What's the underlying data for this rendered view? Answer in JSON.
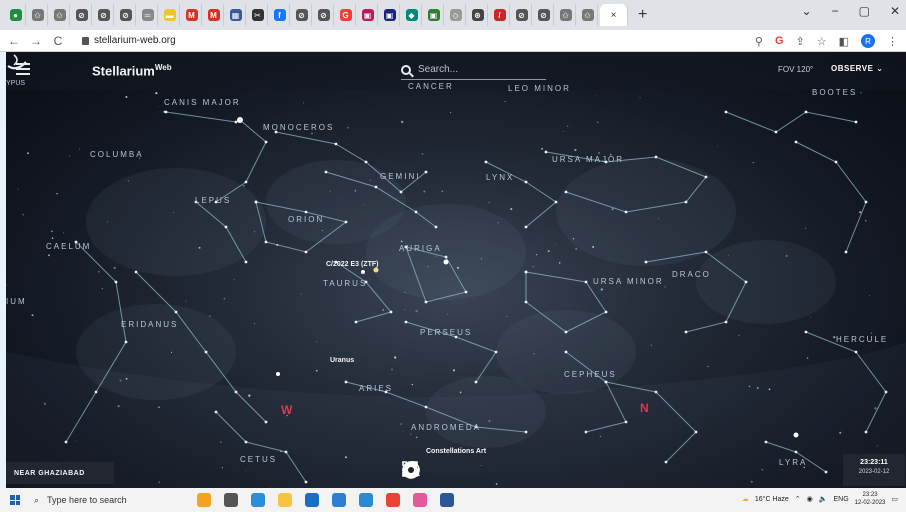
{
  "browser": {
    "tabs": [
      {
        "name": "tab-1",
        "color": "#1e8e3e",
        "glyph": "●"
      },
      {
        "name": "tab-2",
        "color": "#777",
        "glyph": "✩"
      },
      {
        "name": "tab-3",
        "color": "#777",
        "glyph": "✩"
      },
      {
        "name": "tab-4",
        "color": "#555",
        "glyph": "⊘"
      },
      {
        "name": "tab-5",
        "color": "#555",
        "glyph": "⊘"
      },
      {
        "name": "tab-6",
        "color": "#555",
        "glyph": "⊘"
      },
      {
        "name": "tab-7",
        "color": "#888",
        "glyph": "═"
      },
      {
        "name": "tab-8",
        "color": "#f2c230",
        "glyph": "▬"
      },
      {
        "name": "tab-9",
        "color": "#d93025",
        "glyph": "M"
      },
      {
        "name": "tab-10",
        "color": "#d93025",
        "glyph": "M"
      },
      {
        "name": "tab-11",
        "color": "#3b5998",
        "glyph": "▦"
      },
      {
        "name": "tab-12",
        "color": "#333",
        "glyph": "✂"
      },
      {
        "name": "tab-13",
        "color": "#1877f2",
        "glyph": "f"
      },
      {
        "name": "tab-14",
        "color": "#555",
        "glyph": "⊘"
      },
      {
        "name": "tab-15",
        "color": "#555",
        "glyph": "⊘"
      },
      {
        "name": "tab-16",
        "color": "#ea4335",
        "glyph": "G"
      },
      {
        "name": "tab-17",
        "color": "#c2185b",
        "glyph": "▣"
      },
      {
        "name": "tab-18",
        "color": "#1a237e",
        "glyph": "▣"
      },
      {
        "name": "tab-19",
        "color": "#00897b",
        "glyph": "◆"
      },
      {
        "name": "tab-20",
        "color": "#2e7d32",
        "glyph": "▣"
      },
      {
        "name": "tab-21",
        "color": "#999",
        "glyph": "◇"
      },
      {
        "name": "tab-22",
        "color": "#444",
        "glyph": "⊛"
      },
      {
        "name": "tab-23",
        "color": "#c62828",
        "glyph": "/"
      },
      {
        "name": "tab-24",
        "color": "#555",
        "glyph": "⊘"
      },
      {
        "name": "tab-25",
        "color": "#555",
        "glyph": "⊘"
      },
      {
        "name": "tab-26",
        "color": "#777",
        "glyph": "✩"
      },
      {
        "name": "tab-27",
        "color": "#777",
        "glyph": "✩"
      }
    ],
    "active_tab_close": "×",
    "new_tab": "+",
    "window_controls": [
      "⌄",
      "−",
      "▢",
      "✕"
    ],
    "url": "stellarium-web.org",
    "nav": {
      "back": "←",
      "forward": "→",
      "reload": "C"
    },
    "extensions": [
      "⚲",
      "G",
      "⇪",
      "☆",
      "◧"
    ],
    "profile_initial": "R"
  },
  "app": {
    "brand": "Stellarium",
    "brand_sup": "Web",
    "search_placeholder": "Search...",
    "fov": "FOV 120°",
    "observe": "OBSERVE",
    "location": "NEAR GHAZIABAD",
    "time": "23:23:11",
    "date": "2023-02-12",
    "tooltip": "Constellations Art",
    "accent": "#e0394a",
    "constellations": [
      "CANIS MAJOR",
      "MONOCEROS",
      "CANCER",
      "LEO MINOR",
      "BOOTES",
      "COLUMBA",
      "GEMINI",
      "LYNX",
      "URSA MAJOR",
      "LEPUS",
      "ORION",
      "CAELUM",
      "AURIGA",
      "TAURUS",
      "URSA MINOR",
      "DRACO",
      "ERIDANUS",
      "PERSEUS",
      "HERCULE",
      "ARIES",
      "CEPHEUS",
      "ANDROMEDA",
      "CETUS",
      "LYRA",
      "IUM",
      "YPUS"
    ],
    "planets": [
      "C/2022 E3 (ZTF)",
      "Uranus"
    ],
    "cardinals": {
      "west": "W",
      "north": "N"
    },
    "toolbar": [
      "constellation-lines-icon",
      "constellation-art-icon",
      "landscape-icon",
      "atmosphere-icon",
      "azimuthal-grid-icon",
      "equatorial-grid-icon",
      "deep-sky-icon",
      "night-mode-icon",
      "fullscreen-icon"
    ]
  },
  "taskbar": {
    "search_placeholder": "Type here to search",
    "apps": [
      {
        "name": "app-paint",
        "color": "#f4a31e"
      },
      {
        "name": "app-taskview",
        "color": "#555"
      },
      {
        "name": "app-edge",
        "color": "#2b8fd8"
      },
      {
        "name": "app-explorer",
        "color": "#f5c542"
      },
      {
        "name": "app-store",
        "color": "#1b6ec2"
      },
      {
        "name": "app-photos",
        "color": "#2d7dd2"
      },
      {
        "name": "app-chrome-1",
        "color": "#2a8ad4"
      },
      {
        "name": "app-chrome-2",
        "color": "#ea4335"
      },
      {
        "name": "app-tool",
        "color": "#e25a9c"
      },
      {
        "name": "app-word",
        "color": "#2b579a"
      }
    ],
    "weather": "16°C  Haze",
    "lang": "ENG",
    "clock_time": "23:23",
    "clock_date": "12-02-2023"
  }
}
